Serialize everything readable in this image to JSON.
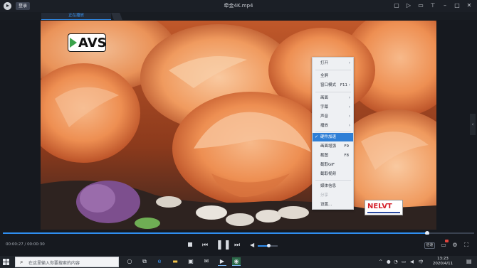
{
  "titlebar": {
    "login_label": "登录",
    "title": "牵金4K.mp4",
    "icons": [
      "minimize-mode-icon",
      "playlist-icon",
      "fullscreen-icon",
      "pin-icon",
      "minimize-icon",
      "maximize-icon",
      "close-icon"
    ]
  },
  "tab": {
    "label": "正在播放"
  },
  "video": {
    "logo_text": "AVS",
    "watermark_text": "NELVT"
  },
  "context_menu": {
    "items": [
      {
        "label": "打开",
        "submenu": true
      },
      {
        "label": "全屏",
        "shortcut": ""
      },
      {
        "label": "窗口模式",
        "shortcut": "F11",
        "submenu": true
      },
      {
        "label": "画面",
        "submenu": true
      },
      {
        "label": "字幕",
        "submenu": true
      },
      {
        "label": "声音",
        "submenu": true
      },
      {
        "label": "播放",
        "submenu": true
      },
      {
        "label": "硬件加速",
        "checked": true
      },
      {
        "label": "画面增强",
        "shortcut": "F9"
      },
      {
        "label": "截图",
        "shortcut": "F8"
      },
      {
        "label": "截取GIF"
      },
      {
        "label": "截取视频"
      },
      {
        "label": "媒体信息"
      },
      {
        "label": "分享",
        "disabled": true
      },
      {
        "label": "设置..."
      }
    ]
  },
  "playback": {
    "current_time": "00:00:27",
    "total_time": "00:00:30",
    "progress": 0.9,
    "volume": 0.55,
    "speed_label": "倍速"
  },
  "taskbar": {
    "search_placeholder": "在这里输入你要搜索的内容",
    "time": "13:23",
    "date": "2020/4/11",
    "ime_label": "中"
  },
  "colors": {
    "accent": "#2f8ef0",
    "menu_highlight": "#2f7fd6",
    "background": "#16191f"
  }
}
